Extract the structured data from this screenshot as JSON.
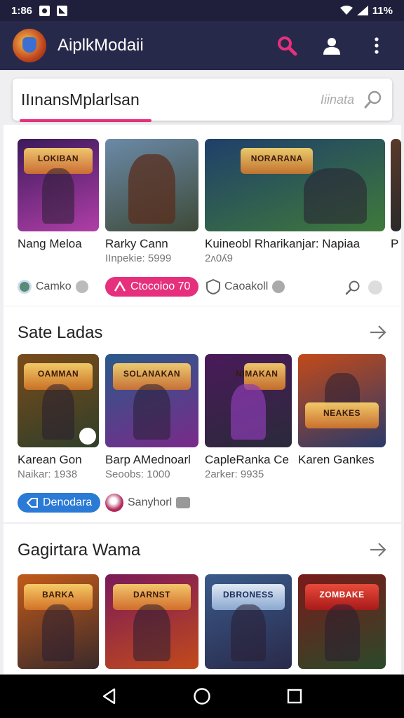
{
  "status_bar": {
    "time": "1:86",
    "battery": "11%"
  },
  "app_bar": {
    "title": "AiplkModaii",
    "icons": [
      "search-icon",
      "account-icon",
      "more-vert-icon"
    ],
    "accent": "#e6307c"
  },
  "search": {
    "value": "IIınansMplarlsan",
    "placeholder": "Iiinata"
  },
  "section1": {
    "games": [
      {
        "name": "Nang Meloa",
        "sub": "",
        "art": "LOKIBAN",
        "colors": [
          "#3b1a5a",
          "#b03ea8"
        ]
      },
      {
        "name": "Rarky Cann",
        "sub": "IInpekie: 5999",
        "art": "",
        "colors": [
          "#6b8aa8",
          "#3e4a38"
        ]
      },
      {
        "name": "Kuineobl Rharikanjar: Napiaa",
        "sub": "2ʌ0ʎ9",
        "art": "NORARANA",
        "colors": [
          "#1f3f6a",
          "#3f7a3a"
        ]
      }
    ],
    "chips": [
      {
        "label": "Camko",
        "style": "plain"
      },
      {
        "label": "Ctocoioo 70",
        "style": "pill"
      },
      {
        "label": "Caoakoll",
        "style": "plain"
      }
    ]
  },
  "section2": {
    "title": "Sate Ladas",
    "games": [
      {
        "name": "Karean Gon",
        "sub": "Naikar: 1938",
        "art": "OAMMAN",
        "colors": [
          "#7a4a1a",
          "#2f3f2a"
        ]
      },
      {
        "name": "Barp AMednoarl",
        "sub": "Seoobs: 1000",
        "art": "SOLANAKAN",
        "colors": [
          "#2a5a8a",
          "#7a2a8a"
        ]
      },
      {
        "name": "CapleRanka Ce",
        "sub": "2arker: 9935",
        "art": "NIMAKAN",
        "colors": [
          "#4a1a5a",
          "#2a2a3a"
        ]
      },
      {
        "name": "Karen Gankes",
        "sub": "",
        "art": "NEAKES",
        "colors": [
          "#c24a1a",
          "#2a3a6a"
        ]
      }
    ],
    "chips": [
      {
        "label": "Denodara",
        "style": "pill"
      },
      {
        "label": "Sanyhorl",
        "style": "plain"
      }
    ]
  },
  "section3": {
    "title": "Gagirtara Wama",
    "games": [
      {
        "art": "BARKA",
        "colors": [
          "#c25a1a",
          "#3a2a2a"
        ]
      },
      {
        "art": "DARNST",
        "colors": [
          "#7a1a5a",
          "#c24a1a"
        ]
      },
      {
        "art": "DBRONESS",
        "colors": [
          "#3a5a8a",
          "#2a2a4a"
        ]
      },
      {
        "art": "ZOMBAKE",
        "colors": [
          "#7a1a1a",
          "#2a4a2a"
        ]
      }
    ]
  },
  "nav": {
    "icons": [
      "back-icon",
      "home-icon",
      "recents-icon"
    ]
  },
  "colors": {
    "app_bar": "#27294a",
    "status_bar": "#1f1f3c",
    "pink": "#e6307c",
    "blue": "#2a7ad6"
  }
}
